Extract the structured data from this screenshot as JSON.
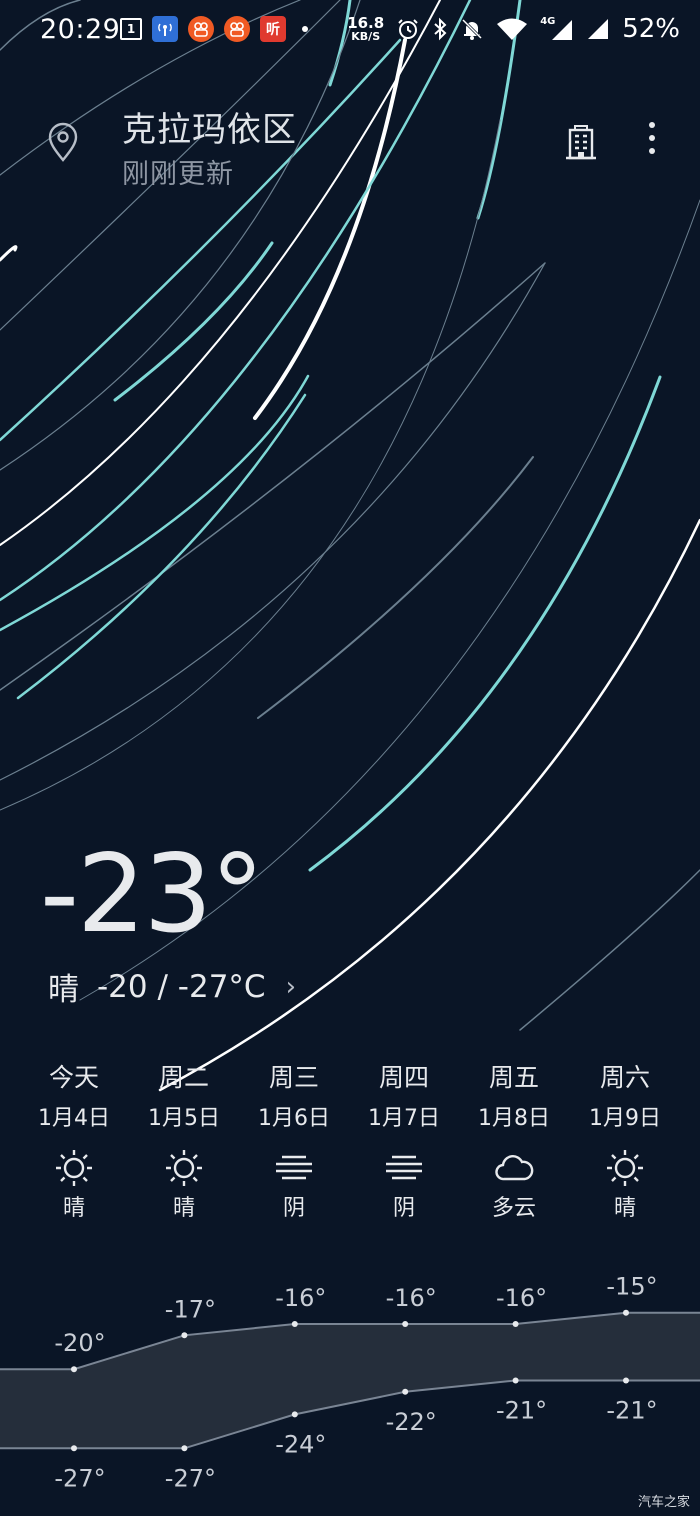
{
  "status_bar": {
    "time": "20:29",
    "notification_badge": "1",
    "listen_app_label": "听",
    "net_speed_value": "16.8",
    "net_speed_unit": "KB/S",
    "network_type": "4G",
    "battery": "52%",
    "icons": [
      "calendar-badge-icon",
      "signal-app-icon",
      "app-icon",
      "app-icon",
      "listen-app-icon",
      "dot-icon",
      "alarm-icon",
      "bluetooth-icon",
      "mute-bell-icon",
      "wifi-icon",
      "cell-signal-icon",
      "cell-signal-icon"
    ]
  },
  "header": {
    "location_icon": "location-pin-icon",
    "city": "克拉玛依区",
    "update_status": "刚刚更新",
    "city_list_icon": "building-icon",
    "menu_icon": "more-vertical-icon"
  },
  "current": {
    "temperature": "-23°",
    "condition": "晴",
    "range": "-20 / -27°C",
    "chevron": "›"
  },
  "forecast": [
    {
      "day": "今天",
      "date": "1月4日",
      "condition": "晴",
      "icon": "sun-icon",
      "high": -20,
      "low": -27,
      "high_label": "-20°",
      "low_label": "-27°"
    },
    {
      "day": "周二",
      "date": "1月5日",
      "condition": "晴",
      "icon": "sun-icon",
      "high": -17,
      "low": -27,
      "high_label": "-17°",
      "low_label": "-27°"
    },
    {
      "day": "周三",
      "date": "1月6日",
      "condition": "阴",
      "icon": "overcast-icon",
      "high": -16,
      "low": -24,
      "high_label": "-16°",
      "low_label": "-24°"
    },
    {
      "day": "周四",
      "date": "1月7日",
      "condition": "阴",
      "icon": "overcast-icon",
      "high": -16,
      "low": -22,
      "high_label": "-16°",
      "low_label": "-22°"
    },
    {
      "day": "周五",
      "date": "1月8日",
      "condition": "多云",
      "icon": "cloud-icon",
      "high": -16,
      "low": -21,
      "high_label": "-16°",
      "low_label": "-21°"
    },
    {
      "day": "周六",
      "date": "1月9日",
      "condition": "晴",
      "icon": "sun-icon",
      "high": -15,
      "low": -21,
      "high_label": "-15°",
      "low_label": "-21°"
    }
  ],
  "colors": {
    "background": "#0a1526",
    "streak_white": "#ffffff",
    "streak_teal": "#7fd8d6",
    "streak_gray": "#6b7f8f",
    "band_fill": "#2a3340"
  },
  "watermark": "汽车之家"
}
